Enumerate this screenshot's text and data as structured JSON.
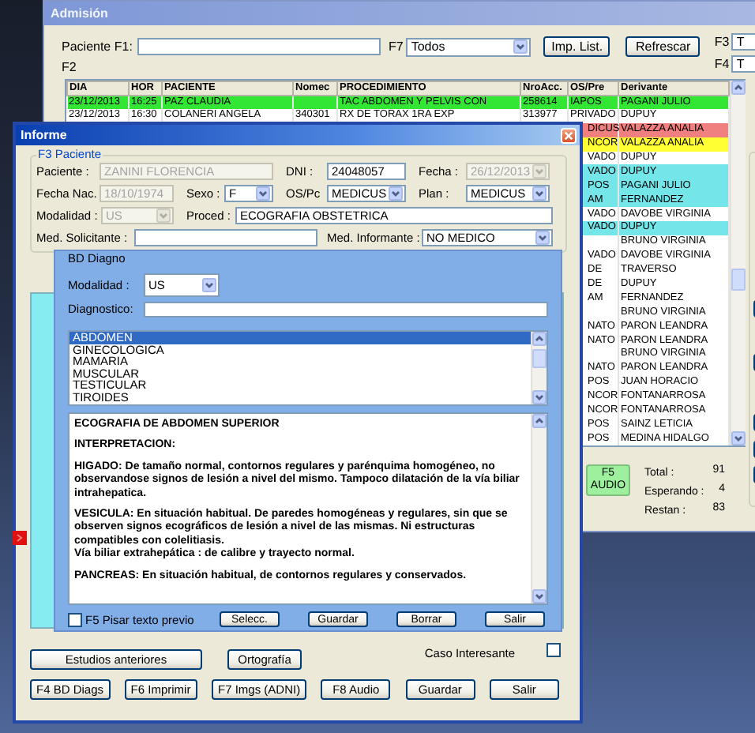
{
  "admision": {
    "title": "Admisión",
    "search": {
      "label": "Paciente F1:"
    },
    "filter": {
      "label": "F7",
      "value": "Todos"
    },
    "buttons": [
      "Imp. List.",
      "Refrescar"
    ],
    "table_label": "F2",
    "side_fields": [
      {
        "label": "F3",
        "value": "T"
      },
      {
        "label": "F4",
        "value": "T"
      }
    ],
    "table": {
      "columns": [
        {
          "label": "DIA"
        },
        {
          "label": "HOR"
        },
        {
          "label": "PACIENTE"
        },
        {
          "label": "Nomec"
        },
        {
          "label": "PROCEDIMIENTO"
        },
        {
          "label": "NroAcc."
        },
        {
          "label": "OS/Pre"
        },
        {
          "label": "Derivante"
        }
      ],
      "rows": [
        {
          "dia": "23/12/2013",
          "hora": "16:25",
          "paciente": "PAZ CLAUDIA",
          "procedimiento": "TAC ABDOMEN Y PELVIS CON",
          "nro_acc": "258614",
          "os_prep": "IAPOS",
          "derivante": "PAGANI JULIO",
          "color": "#33e633"
        },
        {
          "dia": "23/12/2013",
          "hora": "16:30",
          "paciente": "COLANERI ANGELA",
          "nomec": "340301",
          "procedimiento": "RX DE TORAX 1RA EXP",
          "nro_acc": "313977",
          "os_prep": "PRIVADO",
          "derivante": "DUPUY",
          "color": "#ffffff"
        },
        {
          "os_prep": "DICUS",
          "derivante": "VALAZZA ANALIA",
          "color": "#f08080"
        },
        {
          "os_prep": "NCOR",
          "derivante": "VALAZZA ANALIA",
          "color": "#ffff33"
        },
        {
          "os_prep": "VADO",
          "derivante": "DUPUY",
          "color": "#ffffff"
        },
        {
          "os_prep": "VADO",
          "derivante": "DUPUY",
          "color": "#74e6ea"
        },
        {
          "os_prep": "POS",
          "derivante": "PAGANI JULIO",
          "color": "#74e6ea"
        },
        {
          "os_prep": "AM",
          "derivante": "FERNANDEZ",
          "color": "#74e6ea"
        },
        {
          "os_prep": "VADO",
          "derivante": "DAVOBE VIRGINIA",
          "color": "#ffffff"
        },
        {
          "os_prep": "VADO",
          "derivante": "DUPUY",
          "color": "#74e6ea"
        },
        {
          "derivante": "BRUNO VIRGINIA",
          "color": "#ffffff"
        },
        {
          "os_prep": "VADO",
          "derivante": "DAVOBE VIRGINIA",
          "color": "#ffffff"
        },
        {
          "os_prep": "DE",
          "derivante": "TRAVERSO",
          "color": "#ffffff"
        },
        {
          "os_prep": "DE",
          "derivante": "DUPUY",
          "color": "#ffffff"
        },
        {
          "os_prep": "AM",
          "derivante": "FERNANDEZ",
          "color": "#ffffff"
        },
        {
          "derivante": "BRUNO VIRGINIA",
          "color": "#ffffff"
        },
        {
          "os_prep": "NATO",
          "derivante": "PARON LEANDRA",
          "color": "#ffffff"
        },
        {
          "os_prep": "NATO",
          "derivante": "PARON LEANDRA",
          "color": "#ffffff"
        },
        {
          "derivante": "BRUNO VIRGINIA",
          "color": "#ffffff"
        },
        {
          "os_prep": "NATO",
          "derivante": "PARON LEANDRA",
          "color": "#ffffff"
        },
        {
          "os_prep": "POS",
          "derivante": "JUAN HORACIO",
          "color": "#ffffff"
        },
        {
          "os_prep": "NCOR",
          "derivante": "FONTANARROSA",
          "color": "#ffffff"
        },
        {
          "os_prep": "NCOR",
          "derivante": "FONTANARROSA",
          "color": "#ffffff"
        },
        {
          "os_prep": "POS",
          "derivante": "SAINZ LETICIA",
          "color": "#ffffff"
        },
        {
          "os_prep": "POS",
          "derivante": "MEDINA HIDALGO",
          "color": "#ffffff"
        }
      ]
    },
    "audio_button": "F5 AUDIO",
    "stats": [
      {
        "label": "Total :",
        "value": "91"
      },
      {
        "label": "Esperando :",
        "value": "4"
      },
      {
        "label": "Restan :",
        "value": "83"
      }
    ]
  },
  "informe": {
    "title": "Informe",
    "patient_group": {
      "title": "F3 Paciente",
      "rows": [
        {
          "fields": [
            {
              "label": "Paciente :",
              "value": "ZANINI FLORENCIA",
              "kind": "text",
              "disabled": true
            },
            {
              "label": "DNI :",
              "value": "24048057",
              "kind": "text",
              "disabled": false
            },
            {
              "label": "Fecha :",
              "value": "26/12/2013",
              "kind": "dropdown",
              "disabled": true
            }
          ]
        },
        {
          "fields": [
            {
              "label": "Fecha Nac.",
              "value": "18/10/1974",
              "kind": "text",
              "disabled": true
            },
            {
              "label": "Sexo :",
              "value": "F",
              "kind": "dropdown",
              "disabled": false
            },
            {
              "label": "OS/Pc",
              "value": "MEDICUS",
              "kind": "dropdown",
              "disabled": false
            },
            {
              "label": "Plan :",
              "value": "MEDICUS",
              "kind": "dropdown",
              "disabled": false
            }
          ]
        },
        {
          "fields": [
            {
              "label": "Modalidad :",
              "value": "US",
              "kind": "dropdown",
              "disabled": true
            },
            {
              "label": "Proced :",
              "value": "ECOGRAFIA OBSTETRICA",
              "kind": "text",
              "disabled": false
            }
          ]
        },
        {
          "fields": [
            {
              "label": "Med. Solicitante :",
              "kind": "text",
              "disabled": false
            },
            {
              "label": "Med. Informante :",
              "value": "NO MEDICO",
              "kind": "dropdown",
              "disabled": false
            }
          ]
        }
      ]
    },
    "diagnosis_panel": {
      "title": "BD Diagno",
      "modality": {
        "label": "Modalidad :",
        "value": "US"
      },
      "diagnosis": {
        "label": "Diagnostico:"
      },
      "categories": [
        {
          "label": "ABDOMEN",
          "selected": true
        },
        {
          "label": "GINECOLOGICA",
          "selected": false
        },
        {
          "label": "MAMARIA",
          "selected": false
        },
        {
          "label": "MUSCULAR",
          "selected": false
        },
        {
          "label": "TESTICULAR",
          "selected": false
        },
        {
          "label": "TIROIDES",
          "selected": false
        }
      ],
      "report": [
        "ECOGRAFIA DE ABDOMEN SUPERIOR",
        "INTERPRETACION:",
        "HIGADO: De tamaño normal, contornos regulares y parénquima homogéneo, no observandose  signos de lesión a nivel del mismo. Tampoco dilatación de la vía biliar intrahepatica.",
        "VESICULA: En situación habitual. De paredes homogéneas y regulares, sin que se observen signos ecográficos de lesión a nivel de las mismas. Ni estructuras compatibles con colelitiasis.\nVía biliar extrahepática : de calibre y trayecto normal.",
        "PANCREAS: En situación habitual, de contornos regulares y conservados."
      ],
      "overwrite": {
        "label": "F5 Pisar texto previo",
        "checked": false
      },
      "buttons": [
        "Selecc.",
        "Guardar",
        "Borrar",
        "Salir"
      ]
    },
    "top_actions": [
      "Estudios anteriores",
      "Ortografía"
    ],
    "interesting_case": {
      "label": "Caso Interesante",
      "checked": false
    },
    "actions": [
      "F4 BD Diags",
      "F6 Imprimir",
      "F7 Imgs (ADNI)",
      "F8 Audio",
      "Guardar",
      "Salir"
    ]
  }
}
